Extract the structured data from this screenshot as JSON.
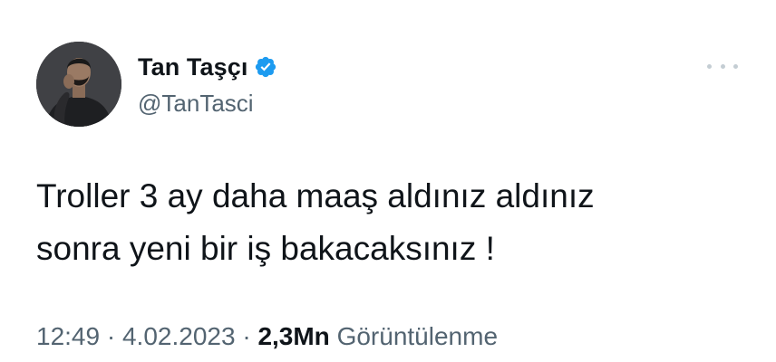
{
  "user": {
    "display_name": "Tan Taşçı",
    "handle": "@TanTasci",
    "verified": true,
    "avatar_icon": "profile-photo"
  },
  "tweet": {
    "text": "Troller 3 ay daha maaş aldınız aldınız\nsonra yeni bir iş bakacaksınız !",
    "time": "12:49",
    "separator": "·",
    "date": "4.02.2023",
    "views_count": "2,3Mn",
    "views_label": "Görüntülenme"
  },
  "colors": {
    "text_primary": "#0f1419",
    "text_secondary": "#536471",
    "verified_badge": "#1d9bf0",
    "more_dots": "#c4cdd3"
  },
  "icons": {
    "verified": "verified-badge-icon",
    "more": "more-options-icon"
  }
}
